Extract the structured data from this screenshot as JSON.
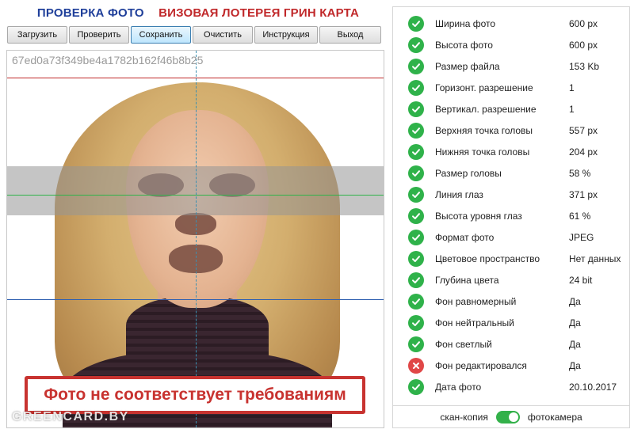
{
  "header": {
    "title_left": "ПРОВЕРКА ФОТО",
    "title_right": "ВИЗОВАЯ ЛОТЕРЕЯ ГРИН КАРТА",
    "colors": {
      "left": "#1f3f9a",
      "right": "#c0282a"
    }
  },
  "toolbar": {
    "buttons": [
      "Загрузить",
      "Проверить",
      "Сохранить",
      "Очистить",
      "Инструкция",
      "Выход"
    ],
    "active": "Сохранить"
  },
  "photo": {
    "hash": "67ed0a73f349be4a1782b162f46b8b25",
    "warning": "Фото не соответствует требованиям",
    "watermark": "GREENCARD.BY"
  },
  "checks": [
    {
      "label": "Ширина фото",
      "value": "600 px",
      "status": "ok"
    },
    {
      "label": "Высота фото",
      "value": "600 px",
      "status": "ok"
    },
    {
      "label": "Размер файла",
      "value": "153 Kb",
      "status": "ok"
    },
    {
      "label": "Горизонт. разрешение",
      "value": "1",
      "status": "ok"
    },
    {
      "label": "Вертикал. разрешение",
      "value": "1",
      "status": "ok"
    },
    {
      "label": "Верхняя точка головы",
      "value": "557 px",
      "status": "ok"
    },
    {
      "label": "Нижняя точка головы",
      "value": "204 px",
      "status": "ok"
    },
    {
      "label": "Размер головы",
      "value": "58 %",
      "status": "ok"
    },
    {
      "label": "Линия глаз",
      "value": "371 px",
      "status": "ok"
    },
    {
      "label": "Высота уровня глаз",
      "value": "61 %",
      "status": "ok"
    },
    {
      "label": "Формат фото",
      "value": "JPEG",
      "status": "ok"
    },
    {
      "label": "Цветовое пространство",
      "value": "Нет данных",
      "status": "ok"
    },
    {
      "label": "Глубина цвета",
      "value": "24 bit",
      "status": "ok"
    },
    {
      "label": "Фон равномерный",
      "value": "Да",
      "status": "ok"
    },
    {
      "label": "Фон нейтральный",
      "value": "Да",
      "status": "ok"
    },
    {
      "label": "Фон светлый",
      "value": "Да",
      "status": "ok"
    },
    {
      "label": "Фон редактировался",
      "value": "Да",
      "status": "fail"
    },
    {
      "label": "Дата фото",
      "value": "20.10.2017",
      "status": "ok"
    }
  ],
  "footer": {
    "left_label": "скан-копия",
    "right_label": "фотокамера",
    "toggle_on": true
  },
  "icons": {
    "ok": "check-circle-icon",
    "fail": "cross-circle-icon"
  },
  "colors": {
    "ok": "#2fb24a",
    "fail": "#e04747",
    "warning": "#c83330"
  }
}
